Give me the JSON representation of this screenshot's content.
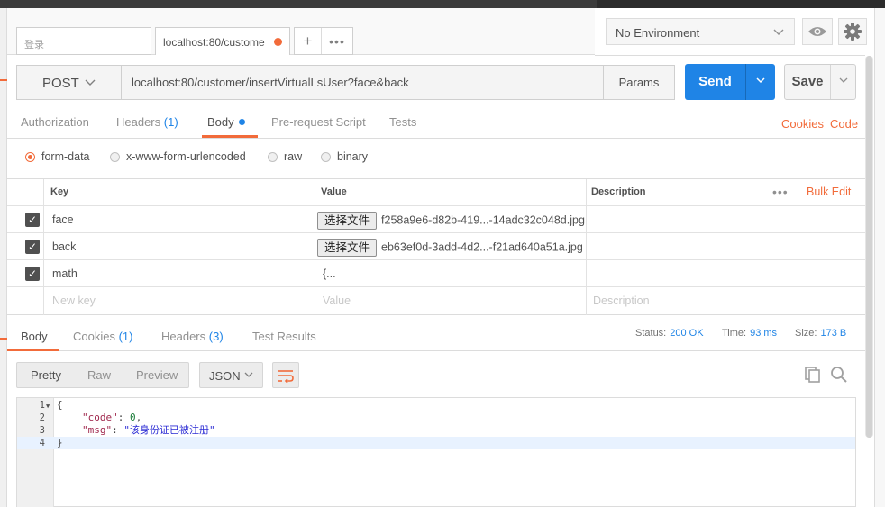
{
  "tabs": {
    "search_placeholder": "登录",
    "active_tab_label": "localhost:80/custome"
  },
  "environment": {
    "selected": "No Environment"
  },
  "request": {
    "method": "POST",
    "url": "localhost:80/customer/insertVirtualLsUser?face&back",
    "params_label": "Params",
    "send_label": "Send",
    "save_label": "Save"
  },
  "request_tabs": {
    "authorization": "Authorization",
    "headers": "Headers",
    "headers_count": "(1)",
    "body": "Body",
    "prerequest": "Pre-request Script",
    "tests": "Tests",
    "cookies_link": "Cookies",
    "code_link": "Code"
  },
  "body_types": [
    "form-data",
    "x-www-form-urlencoded",
    "raw",
    "binary"
  ],
  "params_table": {
    "headers": {
      "key": "Key",
      "value": "Value",
      "description": "Description",
      "bulk_edit": "Bulk Edit"
    },
    "rows": [
      {
        "key": "face",
        "file_button": "选择文件",
        "value": "f258a9e6-d82b-419...-14adc32c048d.jpg"
      },
      {
        "key": "back",
        "file_button": "选择文件",
        "value": "eb63ef0d-3add-4d2...-f21ad640a51a.jpg"
      },
      {
        "key": "math",
        "value": "{..."
      }
    ],
    "placeholders": {
      "key": "New key",
      "value": "Value",
      "description": "Description"
    }
  },
  "response_tabs": {
    "body": "Body",
    "cookies": "Cookies",
    "cookies_count": "(1)",
    "headers": "Headers",
    "headers_count": "(3)",
    "test_results": "Test Results"
  },
  "response_status": {
    "status_label": "Status:",
    "status_value": "200 OK",
    "time_label": "Time:",
    "time_value": "93 ms",
    "size_label": "Size:",
    "size_value": "173 B"
  },
  "response_view": {
    "options": [
      "Pretty",
      "Raw",
      "Preview"
    ],
    "format": "JSON"
  },
  "response_body": {
    "line_numbers": [
      "1",
      "2",
      "3",
      "4"
    ],
    "open_brace": "{",
    "code_key": "\"code\"",
    "code_value": "0",
    "msg_key": "\"msg\"",
    "msg_value": "\"该身份证已被注册\"",
    "close_brace": "}"
  },
  "colors": {
    "accent_orange": "#f26b3a",
    "send_blue": "#1f84e6"
  },
  "icons": [
    "eye-icon",
    "gear-icon",
    "chevron-down-icon",
    "wrap-lines-icon",
    "copy-icon",
    "search-icon",
    "check-icon"
  ]
}
